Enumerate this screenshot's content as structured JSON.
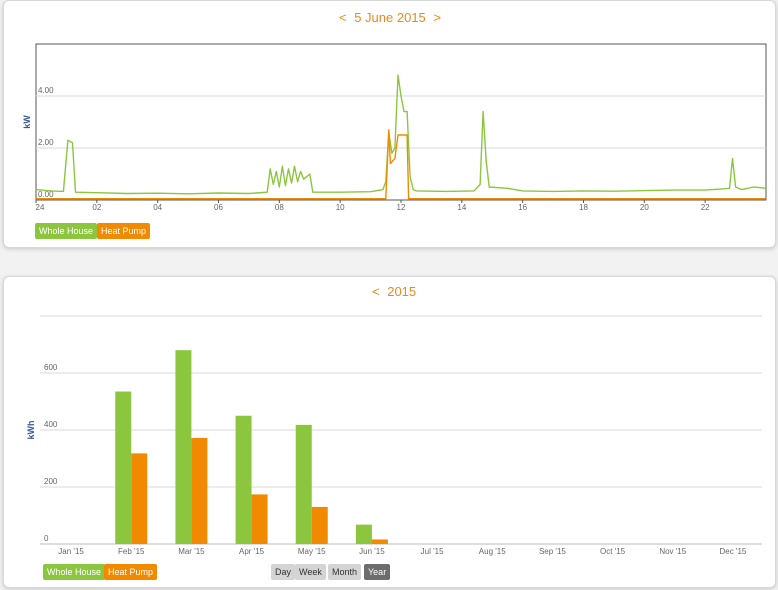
{
  "colors": {
    "whole_house": "#8cc63f",
    "heat_pump": "#f28a00",
    "title": "#e88a1a",
    "axis_label": "#3a5a9a",
    "grid": "#d9d9d9"
  },
  "top_panel": {
    "prev_label": "<",
    "title": "5 June 2015",
    "next_label": ">",
    "legend": [
      "Whole House",
      "Heat Pump"
    ]
  },
  "bottom_panel": {
    "prev_label": "<",
    "title": "2015",
    "legend": [
      "Whole House",
      "Heat Pump"
    ],
    "period_buttons": [
      {
        "label": "Day",
        "active": false
      },
      {
        "label": "Week",
        "active": false
      },
      {
        "label": "Month",
        "active": false
      },
      {
        "label": "Year",
        "active": true
      }
    ]
  },
  "chart_data": [
    {
      "type": "line",
      "ylabel": "kW",
      "ylim": [
        0,
        6
      ],
      "yticks": [
        0,
        2,
        4
      ],
      "ytick_labels": [
        "0.00",
        "2.00",
        "4.00"
      ],
      "xlim": [
        0,
        24
      ],
      "xticks": [
        0,
        2,
        4,
        6,
        8,
        10,
        12,
        14,
        16,
        18,
        20,
        22
      ],
      "xtick_labels": [
        "24",
        "02",
        "04",
        "06",
        "08",
        "10",
        "12",
        "14",
        "16",
        "18",
        "20",
        "22"
      ],
      "grid": true,
      "series": [
        {
          "name": "Whole House",
          "color": "#8cc63f",
          "points": [
            [
              0.0,
              0.4
            ],
            [
              0.5,
              0.35
            ],
            [
              0.9,
              0.33
            ],
            [
              1.05,
              2.3
            ],
            [
              1.2,
              2.2
            ],
            [
              1.3,
              0.3
            ],
            [
              2.0,
              0.28
            ],
            [
              3.0,
              0.25
            ],
            [
              4.0,
              0.26
            ],
            [
              5.0,
              0.24
            ],
            [
              6.0,
              0.27
            ],
            [
              7.0,
              0.25
            ],
            [
              7.6,
              0.3
            ],
            [
              7.7,
              1.2
            ],
            [
              7.8,
              0.6
            ],
            [
              7.9,
              1.1
            ],
            [
              8.0,
              0.5
            ],
            [
              8.1,
              1.3
            ],
            [
              8.2,
              0.55
            ],
            [
              8.3,
              1.2
            ],
            [
              8.4,
              0.65
            ],
            [
              8.5,
              1.3
            ],
            [
              8.6,
              0.7
            ],
            [
              8.7,
              1.1
            ],
            [
              8.8,
              0.8
            ],
            [
              9.0,
              1.0
            ],
            [
              9.1,
              0.3
            ],
            [
              10.0,
              0.3
            ],
            [
              11.0,
              0.32
            ],
            [
              11.4,
              0.4
            ],
            [
              11.5,
              0.7
            ],
            [
              11.6,
              2.6
            ],
            [
              11.7,
              1.8
            ],
            [
              11.8,
              2.0
            ],
            [
              11.9,
              4.8
            ],
            [
              12.0,
              4.0
            ],
            [
              12.1,
              3.4
            ],
            [
              12.2,
              3.4
            ],
            [
              12.3,
              0.9
            ],
            [
              12.4,
              0.4
            ],
            [
              12.5,
              0.35
            ],
            [
              13.5,
              0.33
            ],
            [
              14.4,
              0.35
            ],
            [
              14.6,
              0.6
            ],
            [
              14.7,
              3.4
            ],
            [
              14.8,
              1.5
            ],
            [
              14.9,
              0.5
            ],
            [
              15.5,
              0.45
            ],
            [
              16.0,
              0.35
            ],
            [
              17.0,
              0.33
            ],
            [
              18.0,
              0.35
            ],
            [
              19.0,
              0.34
            ],
            [
              20.0,
              0.36
            ],
            [
              21.0,
              0.38
            ],
            [
              22.0,
              0.38
            ],
            [
              22.5,
              0.42
            ],
            [
              22.8,
              0.45
            ],
            [
              22.9,
              1.6
            ],
            [
              23.0,
              0.5
            ],
            [
              23.2,
              0.4
            ],
            [
              23.6,
              0.5
            ],
            [
              24.0,
              0.45
            ]
          ]
        },
        {
          "name": "Heat Pump",
          "color": "#f28a00",
          "points": [
            [
              0.0,
              0.05
            ],
            [
              11.5,
              0.05
            ],
            [
              11.6,
              2.7
            ],
            [
              11.65,
              1.4
            ],
            [
              11.8,
              1.6
            ],
            [
              11.9,
              2.5
            ],
            [
              12.2,
              2.5
            ],
            [
              12.25,
              0.05
            ],
            [
              24.0,
              0.05
            ]
          ]
        }
      ]
    },
    {
      "type": "bar",
      "ylabel": "kWh",
      "ylim": [
        0,
        800
      ],
      "yticks": [
        0,
        200,
        400,
        600
      ],
      "ytick_labels": [
        "0",
        "200",
        "400",
        "600"
      ],
      "grid": true,
      "categories": [
        "Jan '15",
        "Feb '15",
        "Mar '15",
        "Apr '15",
        "May '15",
        "Jun '15",
        "Jul '15",
        "Aug '15",
        "Sep '15",
        "Oct '15",
        "Nov '15",
        "Dec '15"
      ],
      "series": [
        {
          "name": "Whole House",
          "color": "#8cc63f",
          "values": [
            0,
            535,
            680,
            450,
            418,
            68,
            0,
            0,
            0,
            0,
            0,
            0
          ]
        },
        {
          "name": "Heat Pump",
          "color": "#f28a00",
          "values": [
            0,
            318,
            372,
            174,
            130,
            16,
            0,
            0,
            0,
            0,
            0,
            0
          ]
        }
      ]
    }
  ]
}
